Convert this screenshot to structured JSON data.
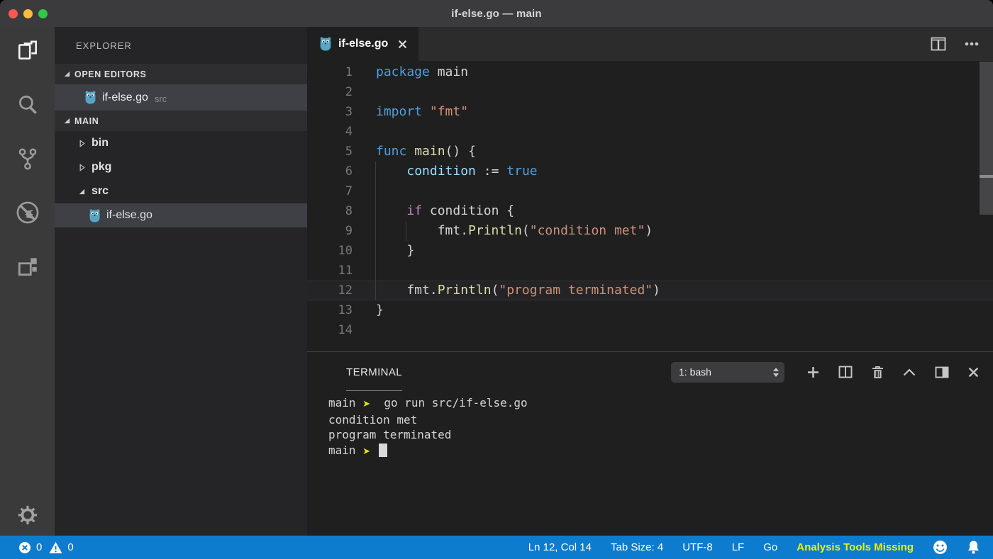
{
  "window": {
    "title": "if-else.go — main",
    "traffic_lights": {
      "close": "#fc5753",
      "minimize": "#fdbc40",
      "zoom": "#33c748"
    }
  },
  "activity_bar": {
    "items": [
      "explorer-icon",
      "search-icon",
      "source-control-icon",
      "debug-icon",
      "extensions-icon"
    ],
    "active_item": "explorer-icon",
    "bottom": "settings-gear-icon"
  },
  "sidebar": {
    "title": "EXPLORER",
    "open_editors": {
      "label": "OPEN EDITORS",
      "items": [
        {
          "label": "if-else.go",
          "detail": "src",
          "icon": "go-gopher-icon",
          "selected": true
        }
      ]
    },
    "main_section": {
      "label": "MAIN",
      "tree": [
        {
          "type": "folder",
          "label": "bin",
          "expanded": false,
          "nested": false,
          "selected": false
        },
        {
          "type": "folder",
          "label": "pkg",
          "expanded": false,
          "nested": false,
          "selected": false
        },
        {
          "type": "folder",
          "label": "src",
          "expanded": true,
          "nested": false,
          "selected": false
        },
        {
          "type": "file",
          "label": "if-else.go",
          "icon": "go-gopher-icon",
          "nested": true,
          "selected": true
        }
      ]
    }
  },
  "editor": {
    "tab": {
      "label": "if-else.go",
      "icon": "go-gopher-icon"
    },
    "lines": [
      {
        "num": 1,
        "tokens": [
          [
            "kw",
            "package"
          ],
          [
            "pl",
            " main"
          ]
        ]
      },
      {
        "num": 2,
        "tokens": []
      },
      {
        "num": 3,
        "tokens": [
          [
            "kw",
            "import"
          ],
          [
            "pl",
            " "
          ],
          [
            "str",
            "\"fmt\""
          ]
        ]
      },
      {
        "num": 4,
        "tokens": []
      },
      {
        "num": 5,
        "tokens": [
          [
            "kw",
            "func"
          ],
          [
            "pl",
            " "
          ],
          [
            "fn",
            "main"
          ],
          [
            "pl",
            "() {"
          ]
        ]
      },
      {
        "num": 6,
        "guides": [
          0
        ],
        "tokens": [
          [
            "pl",
            "    "
          ],
          [
            "var",
            "condition"
          ],
          [
            "pl",
            " := "
          ],
          [
            "kw",
            "true"
          ]
        ]
      },
      {
        "num": 7,
        "guides": [
          0
        ],
        "tokens": []
      },
      {
        "num": 8,
        "guides": [
          0
        ],
        "tokens": [
          [
            "pl",
            "    "
          ],
          [
            "ctrl",
            "if"
          ],
          [
            "pl",
            " condition {"
          ]
        ]
      },
      {
        "num": 9,
        "guides": [
          0,
          1
        ],
        "tokens": [
          [
            "pl",
            "        fmt."
          ],
          [
            "fn",
            "Println"
          ],
          [
            "pl",
            "("
          ],
          [
            "str",
            "\"condition met\""
          ],
          [
            "pl",
            ")"
          ]
        ]
      },
      {
        "num": 10,
        "guides": [
          0
        ],
        "tokens": [
          [
            "pl",
            "    }"
          ]
        ]
      },
      {
        "num": 11,
        "guides": [
          0
        ],
        "tokens": []
      },
      {
        "num": 12,
        "guides": [
          0
        ],
        "highlight": true,
        "tokens": [
          [
            "pl",
            "    fmt."
          ],
          [
            "fn",
            "Println"
          ],
          [
            "pl",
            "("
          ],
          [
            "str",
            "\"program terminated\""
          ],
          [
            "pl",
            ")"
          ]
        ]
      },
      {
        "num": 13,
        "tokens": [
          [
            "pl",
            "}"
          ]
        ]
      },
      {
        "num": 14,
        "tokens": []
      }
    ]
  },
  "panel": {
    "title": "TERMINAL",
    "dropdown_value": "1: bash",
    "actions": [
      "new-terminal-icon",
      "split-terminal-icon",
      "kill-terminal-icon",
      "maximize-panel-icon",
      "toggle-panel-icon",
      "close-panel-icon"
    ],
    "terminal_lines": [
      {
        "tokens": [
          [
            "pl",
            "main "
          ],
          [
            "prompt",
            "➤"
          ],
          [
            "pl",
            "  go run src/if-else.go"
          ]
        ],
        "cursor": false
      },
      {
        "tokens": [
          [
            "pl",
            "condition met"
          ]
        ],
        "cursor": false
      },
      {
        "tokens": [
          [
            "pl",
            "program terminated"
          ]
        ],
        "cursor": false
      },
      {
        "tokens": [
          [
            "pl",
            "main "
          ],
          [
            "prompt",
            "➤"
          ],
          [
            "pl",
            " "
          ]
        ],
        "cursor": true
      }
    ]
  },
  "status_bar": {
    "errors": "0",
    "warnings": "0",
    "right_items": [
      {
        "label": "Ln 12, Col 14"
      },
      {
        "label": "Tab Size: 4"
      },
      {
        "label": "UTF-8"
      },
      {
        "label": "LF"
      },
      {
        "label": "Go"
      },
      {
        "label": "Analysis Tools Missing",
        "color": "#f1f100"
      }
    ],
    "icons": [
      "feedback-smiley-icon",
      "notifications-bell-icon"
    ]
  },
  "colors": {
    "statusbar_accent": "#0d7ccf",
    "highlight_yellow": "#f1f100",
    "prompt_yellow": "#e5e510",
    "gopher_blue": "#57a5c4",
    "keyword_blue": "#569cd6",
    "control_pink": "#c586c0",
    "function_yellow": "#dcdcaa",
    "variable_blue": "#9cdcfe",
    "string_orange": "#ce9178"
  }
}
